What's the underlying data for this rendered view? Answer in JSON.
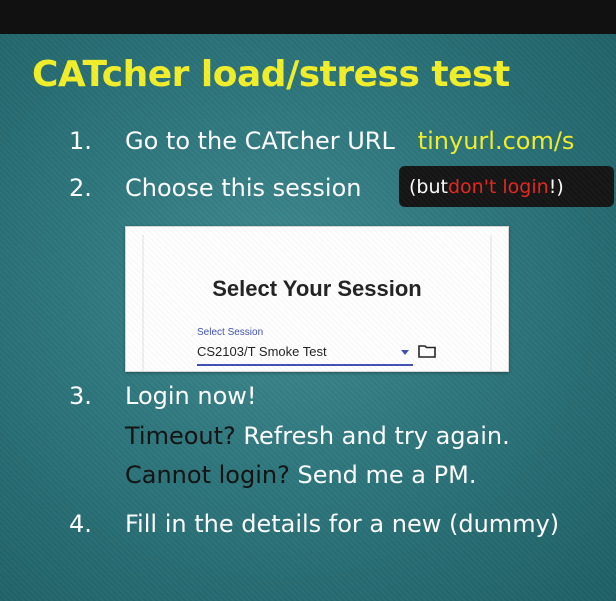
{
  "slide": {
    "title": "CATcher load/stress test",
    "steps": [
      {
        "number": "1.",
        "text": "Go to the CATcher URL",
        "link": "tinyurl.com/s"
      },
      {
        "number": "2.",
        "text": "Choose this session",
        "note_prefix": "(but ",
        "note_red": "don't login",
        "note_suffix": "!)"
      },
      {
        "number": "3.",
        "text": "Login now!",
        "sub1_dark": "Timeout?",
        "sub1_light": "Refresh and try again.",
        "sub2_dark": "Cannot login?",
        "sub2_light": "Send me a PM."
      },
      {
        "number": "4.",
        "text": "Fill in the details for a new (dummy)"
      }
    ]
  },
  "session_card": {
    "title": "Select Your Session",
    "select_label": "Select Session",
    "select_value": "CS2103/T Smoke Test"
  },
  "colors": {
    "background": "#2d767c",
    "title": "#f2ef2a",
    "link": "#f2ef2a",
    "warning": "#e8261f",
    "select_accent": "#3f51b5"
  },
  "icons": [
    "dropdown-arrow-icon",
    "folder-icon"
  ]
}
